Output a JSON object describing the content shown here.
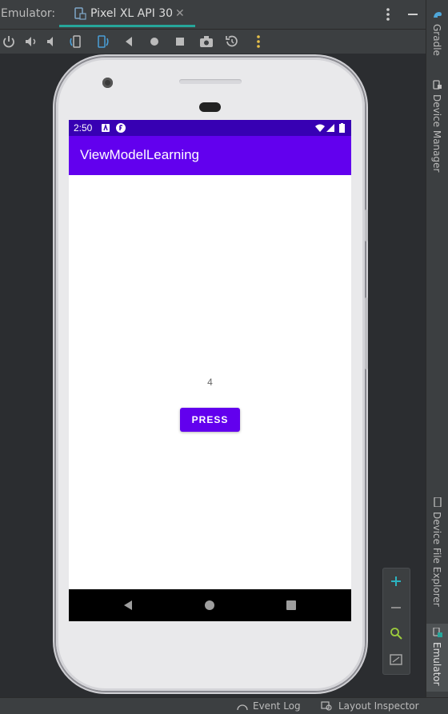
{
  "tabbar": {
    "emulator_label": "Emulator:",
    "device_tab_label": "Pixel XL API 30",
    "close_glyph": "✕"
  },
  "toolbar": {
    "icons": [
      "power-icon",
      "volume-up-icon",
      "volume-down-icon",
      "rotate-left-icon",
      "rotate-right-icon",
      "back-icon",
      "home-icon",
      "overview-icon",
      "screenshot-icon",
      "snapshot-icon",
      "more-icon"
    ]
  },
  "right_sidebar": {
    "gradle_label": "Gradle",
    "device_manager_label": "Device Manager",
    "device_file_explorer_label": "Device File Explorer",
    "emulator_label": "Emulator"
  },
  "statusbar": {
    "event_log_label": "Event Log",
    "layout_inspector_label": "Layout Inspector"
  },
  "device": {
    "status_time": "2:50",
    "app_title": "ViewModelLearning",
    "counter_value": "4",
    "press_button_label": "PRESS"
  },
  "colors": {
    "accent_teal": "#26a69a",
    "status_bar": "#3700b3",
    "app_bar": "#6200ee",
    "button": "#6200ee"
  }
}
